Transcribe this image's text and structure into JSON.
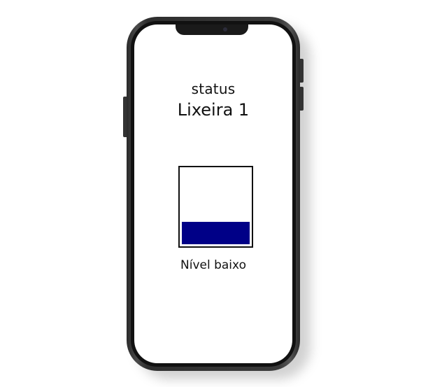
{
  "screen": {
    "status_label": "status",
    "title": "Lixeira 1",
    "level_text": "Nível baixo"
  },
  "bin": {
    "fill_fraction": 0.3,
    "fill_color": "#000087",
    "border_color": "#111111"
  },
  "device": {
    "frame_color": "#2e2e2e",
    "screen_color": "#ffffff"
  }
}
